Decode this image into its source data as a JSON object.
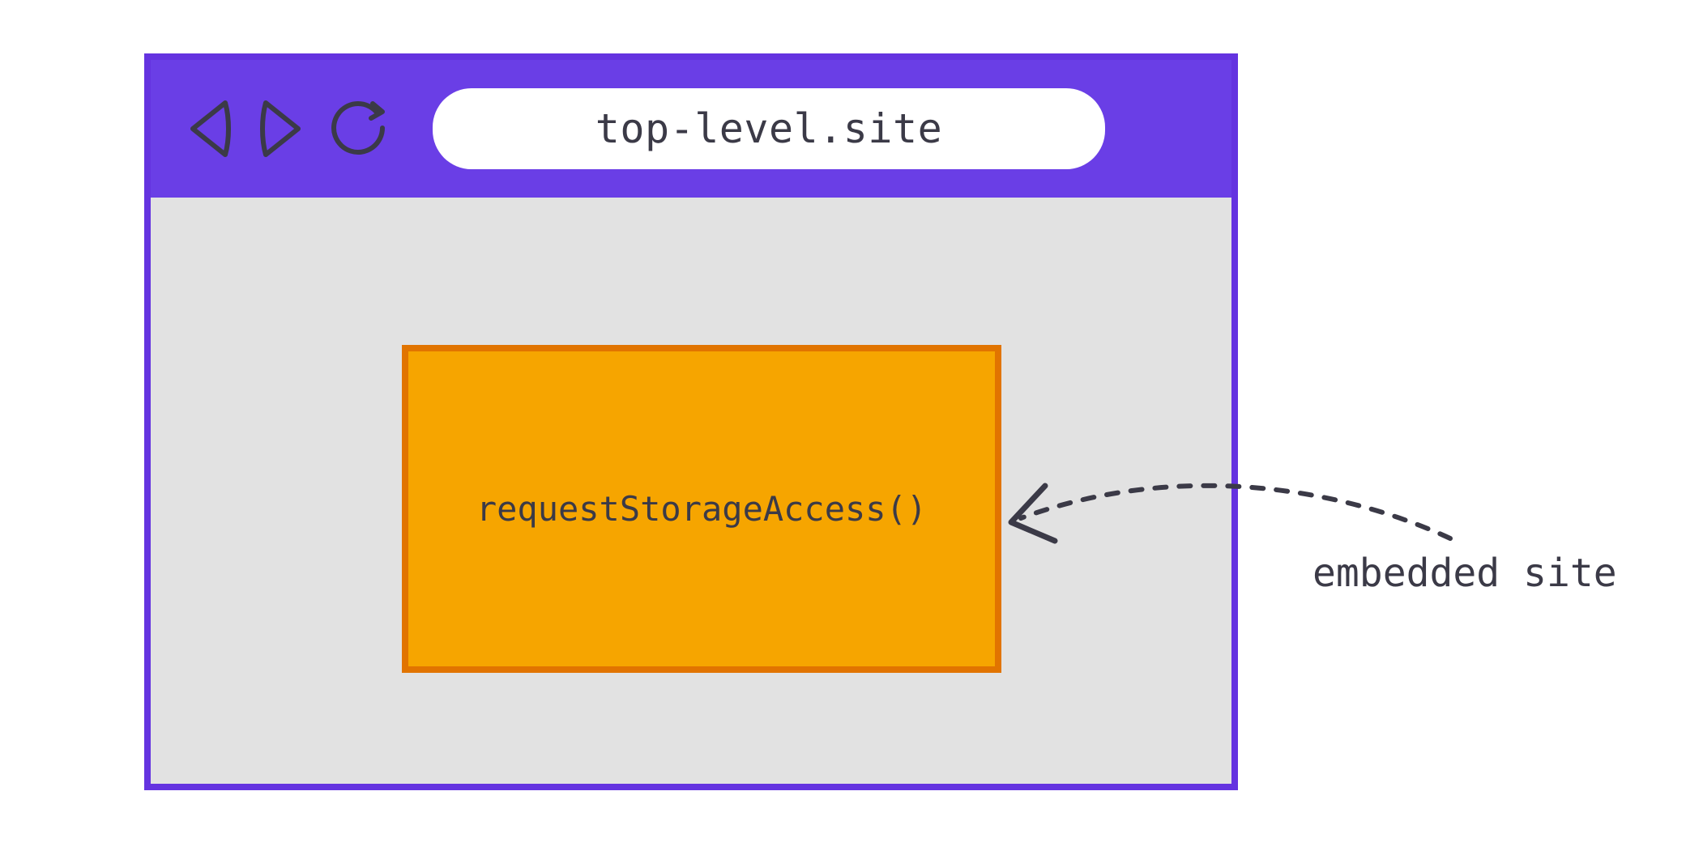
{
  "browser": {
    "url": "top-level.site",
    "icons": {
      "back": "back-icon",
      "forward": "forward-icon",
      "reload": "reload-icon"
    }
  },
  "embed": {
    "label": "requestStorageAccess()"
  },
  "annotation": {
    "label": "embedded site"
  },
  "colors": {
    "browser_frame": "#6433e0",
    "toolbar": "#6a3ee6",
    "page_bg": "#e2e2e2",
    "embed_fill": "#f6a500",
    "embed_border": "#e17400",
    "text": "#3b3a47"
  }
}
